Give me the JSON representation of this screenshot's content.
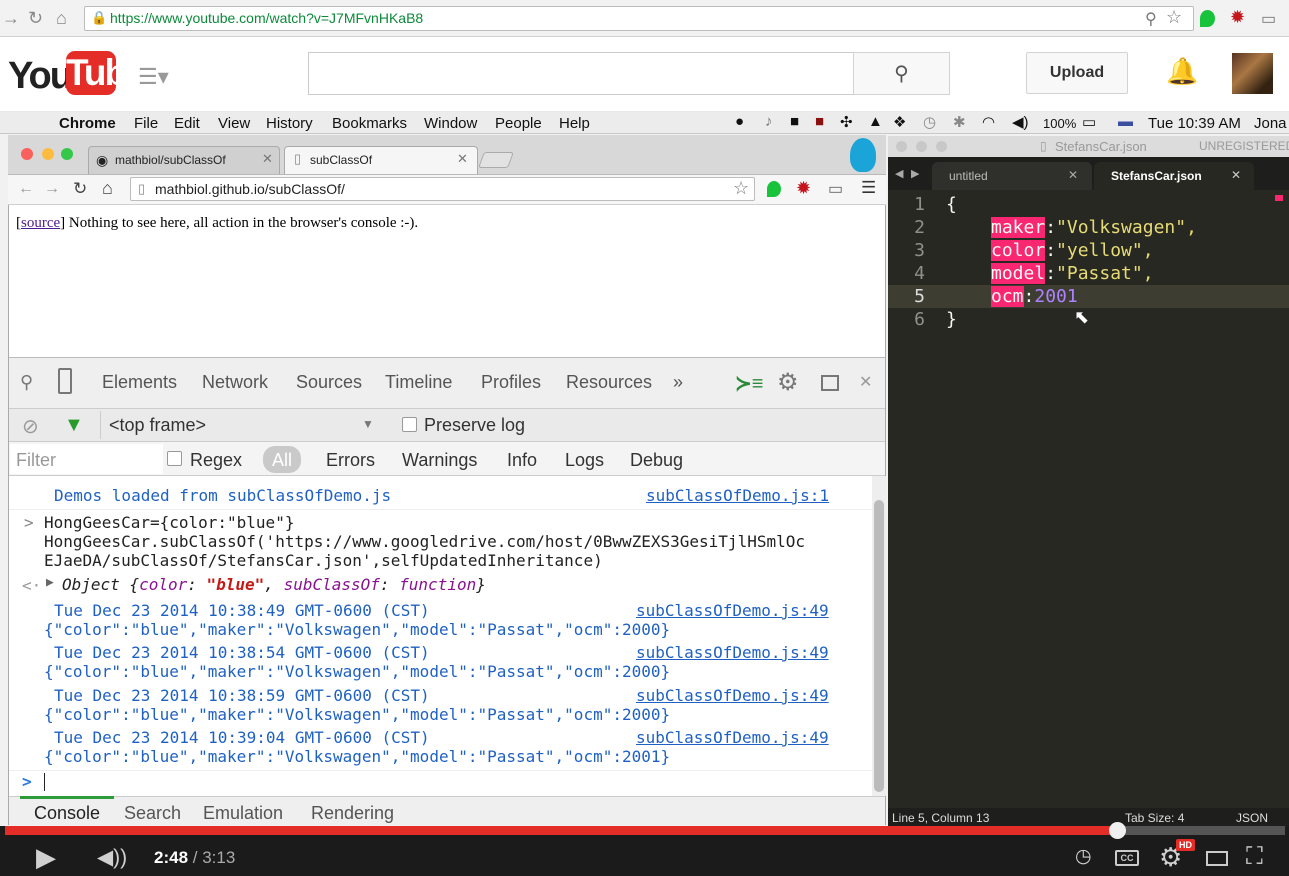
{
  "outer_browser": {
    "url": "https://www.youtube.com/watch?v=J7MFvnHKaB8"
  },
  "youtube": {
    "logo_you": "You",
    "logo_tube": "Tube",
    "upload_label": "Upload",
    "search_placeholder": "",
    "brand_color": "#e52d27"
  },
  "mac_menubar": {
    "items": [
      "Chrome",
      "File",
      "Edit",
      "View",
      "History",
      "Bookmarks",
      "Window",
      "People",
      "Help"
    ],
    "battery": "100%",
    "clock": "Tue 10:39 AM",
    "user": "Jona"
  },
  "inner_browser": {
    "tabs": [
      {
        "label": "mathbiol/subClassOf"
      },
      {
        "label": "subClassOf"
      }
    ],
    "url": "mathbiol.github.io/subClassOf/",
    "page_link": "source",
    "page_text": "] Nothing to see here, all action in the browser's console :-)."
  },
  "devtools": {
    "tabs": [
      "Elements",
      "Network",
      "Sources",
      "Timeline",
      "Profiles",
      "Resources"
    ],
    "frame_select": "<top frame>",
    "preserve_log": "Preserve log",
    "filter_placeholder": "Filter",
    "regex": "Regex",
    "levels": [
      "All",
      "Errors",
      "Warnings",
      "Info",
      "Logs",
      "Debug"
    ],
    "drawer_tabs": [
      "Console",
      "Search",
      "Emulation",
      "Rendering"
    ],
    "console": {
      "demos_line": "Demos loaded from subClassOfDemo.js",
      "demos_src": "subClassOfDemo.js:1",
      "input_line1": "HongGeesCar={color:\"blue\"}",
      "input_line2": "HongGeesCar.subClassOf('https://www.googledrive.com/host/0BwwZEXS3GesiTjlHSmlOc",
      "input_line3": "EJaeDA/subClassOf/StefansCar.json',selfUpdatedInheritance)",
      "result_prefix": "Object {",
      "result_key1": "color",
      "result_val1": "\"blue\"",
      "result_key2": "subClassOf",
      "result_val2": "function",
      "result_suffix": "}",
      "entries": [
        {
          "time": "Tue Dec 23 2014 10:38:49 GMT-0600 (CST)",
          "json": "{\"color\":\"blue\",\"maker\":\"Volkswagen\",\"model\":\"Passat\",\"ocm\":2000}",
          "src": "subClassOfDemo.js:49"
        },
        {
          "time": "Tue Dec 23 2014 10:38:54 GMT-0600 (CST)",
          "json": "{\"color\":\"blue\",\"maker\":\"Volkswagen\",\"model\":\"Passat\",\"ocm\":2000}",
          "src": "subClassOfDemo.js:49"
        },
        {
          "time": "Tue Dec 23 2014 10:38:59 GMT-0600 (CST)",
          "json": "{\"color\":\"blue\",\"maker\":\"Volkswagen\",\"model\":\"Passat\",\"ocm\":2000}",
          "src": "subClassOfDemo.js:49"
        },
        {
          "time": "Tue Dec 23 2014 10:39:04 GMT-0600 (CST)",
          "json": "{\"color\":\"blue\",\"maker\":\"Volkswagen\",\"model\":\"Passat\",\"ocm\":2001}",
          "src": "subClassOfDemo.js:49"
        }
      ]
    }
  },
  "sublime": {
    "window_title": "StefansCar.json",
    "unregistered": "UNREGISTERED",
    "tabs": [
      {
        "label": "untitled"
      },
      {
        "label": "StefansCar.json"
      }
    ],
    "lines": [
      {
        "num": "1",
        "text": "{"
      },
      {
        "num": "2",
        "key": "maker",
        "sep": ":",
        "val": "\"Volkswagen\","
      },
      {
        "num": "3",
        "key": "color",
        "sep": ":",
        "val": "\"yellow\","
      },
      {
        "num": "4",
        "key": "model",
        "sep": ":",
        "val": "\"Passat\","
      },
      {
        "num": "5",
        "key": "ocm",
        "sep": ":",
        "val": "2001"
      },
      {
        "num": "6",
        "text": "}"
      }
    ],
    "status_position": "Line 5, Column 13",
    "status_tabsize": "Tab Size: 4",
    "status_syntax": "JSON"
  },
  "player": {
    "current_time": "2:48",
    "separator": " / ",
    "duration": "3:13",
    "progress_fraction": 0.869,
    "hd_badge": "HD"
  }
}
